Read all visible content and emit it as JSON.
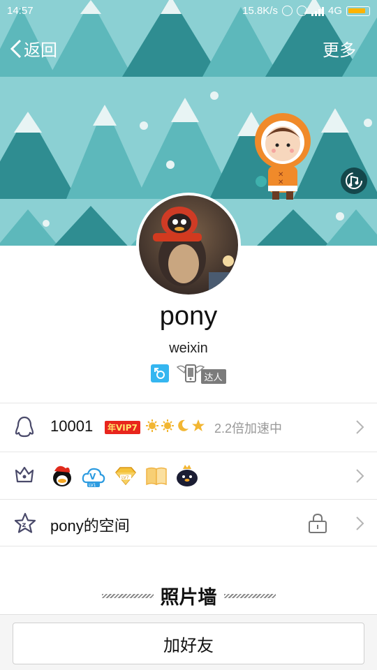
{
  "status_bar": {
    "time": "14:57",
    "network_speed": "15.8K/s",
    "network_type": "4G",
    "battery_color": "#ffb300"
  },
  "nav": {
    "back_label": "返回",
    "more_label": "更多"
  },
  "profile": {
    "nickname": "pony",
    "subname": "weixin",
    "daren_label": "达人"
  },
  "rows": {
    "qq": {
      "icon": "penguin-outline-icon",
      "number": "10001",
      "vip_tag": "年VIP7",
      "speed_text": "2.2倍加速中"
    },
    "medals": {
      "icon": "crown-outline-icon",
      "items": [
        "qq-penguin-medal",
        "vip-cloud-medal",
        "lv7-diamond-medal",
        "book-medal",
        "crowned-penguin-medal"
      ]
    },
    "space": {
      "icon": "star-outline-icon",
      "label": "pony的空间"
    }
  },
  "photo_wall": {
    "title": "照片墙"
  },
  "footer": {
    "add_friend_label": "加好友"
  },
  "colors": {
    "banner_bg": "#8bd0d3",
    "tree_dark": "#2f8d91",
    "tree_light": "#5db8bb",
    "sex_badge": "#35b6f0",
    "vip_red": "#e8251d"
  }
}
